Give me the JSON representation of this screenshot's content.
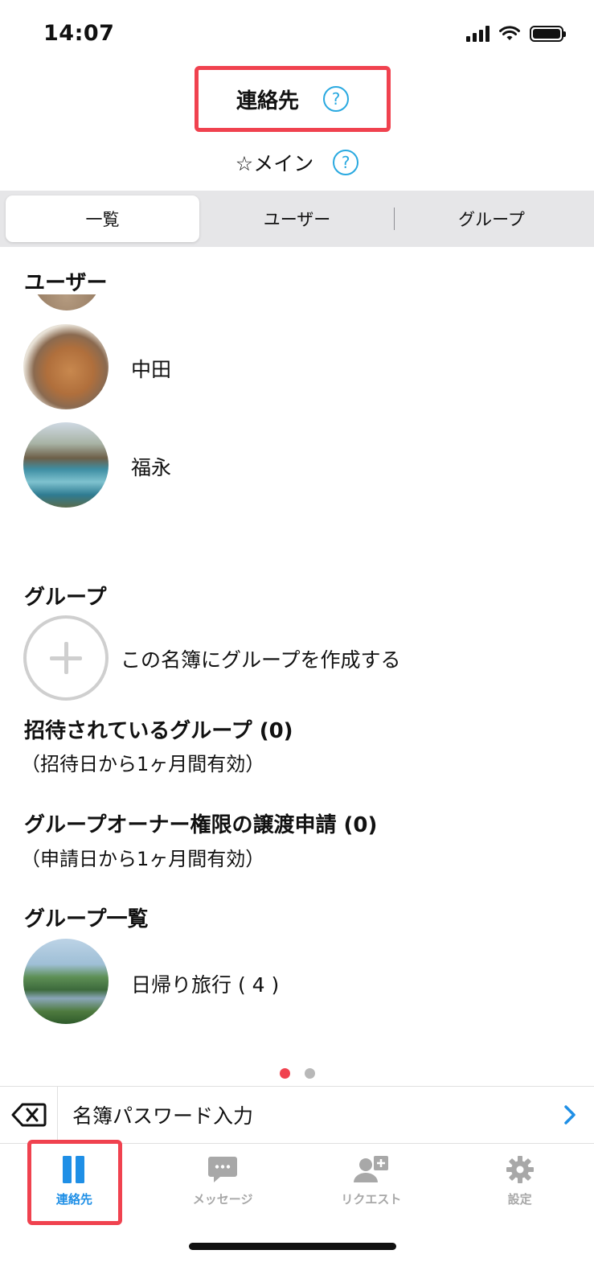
{
  "status_bar": {
    "time": "14:07"
  },
  "header": {
    "title": "連絡先",
    "help_glyph": "?"
  },
  "subheader": {
    "label": "☆メイン",
    "help_glyph": "?"
  },
  "segments": [
    {
      "label": "一覧",
      "selected": true
    },
    {
      "label": "ユーザー",
      "selected": false
    },
    {
      "label": "グループ",
      "selected": false
    }
  ],
  "users_section": {
    "heading": "ユーザー",
    "items": [
      {
        "name": "中田",
        "avatar": "cat-photo"
      },
      {
        "name": "福永",
        "avatar": "lake-photo"
      }
    ]
  },
  "groups_section": {
    "heading": "グループ",
    "create_label": "この名簿にグループを作成する",
    "invited_heading": "招待されているグループ (0)",
    "invited_note": "（招待日から1ヶ月間有効）",
    "transfer_heading": "グループオーナー権限の譲渡申請 (0)",
    "transfer_note": "（申請日から1ヶ月間有効）",
    "list_heading": "グループ一覧",
    "items": [
      {
        "name": "日帰り旅行 ( 4 )",
        "avatar": "coast-photo"
      }
    ]
  },
  "page_dots": {
    "active_color": "#f0424f",
    "inactive_color": "#b8b8b8",
    "count": 2,
    "active_index": 0
  },
  "password_bar": {
    "label": "名簿パスワード入力",
    "chevron_color": "#1f8fe6"
  },
  "tab_bar": [
    {
      "label": "連絡先",
      "icon": "contacts-icon",
      "active": true
    },
    {
      "label": "メッセージ",
      "icon": "message-icon",
      "active": false
    },
    {
      "label": "リクエスト",
      "icon": "request-icon",
      "active": false
    },
    {
      "label": "設定",
      "icon": "gear-icon",
      "active": false
    }
  ],
  "colors": {
    "accent": "#1f8fe6",
    "highlight_border": "#f0424f",
    "help": "#29a9e0"
  }
}
